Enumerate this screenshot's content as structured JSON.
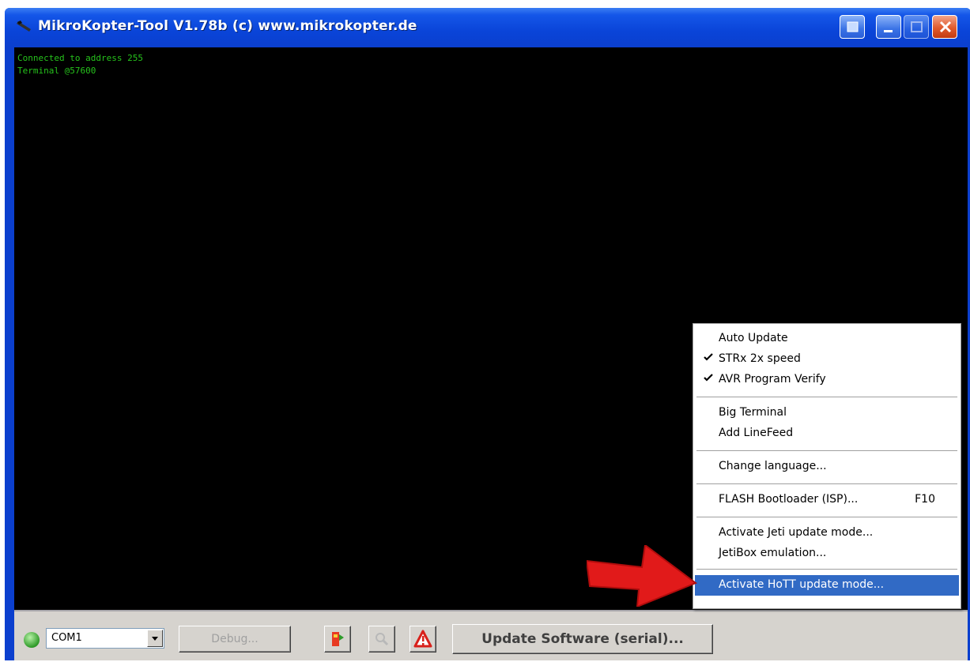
{
  "window": {
    "title": "MikroKopter-Tool V1.78b (c) www.mikrokopter.de"
  },
  "terminal": {
    "lines": [
      "Connected to address 255",
      "Terminal @57600"
    ]
  },
  "statusbar": {
    "port": "COM1",
    "debug_label": "Debug...",
    "update_label": "Update Software (serial)..."
  },
  "menu": {
    "items": [
      {
        "label": "Auto Update",
        "checked": false
      },
      {
        "label": "STRx 2x speed",
        "checked": true
      },
      {
        "label": "AVR Program Verify",
        "checked": true
      },
      {
        "label": "Big Terminal",
        "checked": false
      },
      {
        "label": "Add LineFeed",
        "checked": false
      },
      {
        "label": "Change language...",
        "checked": false
      },
      {
        "label": "FLASH Bootloader (ISP)...",
        "shortcut": "F10",
        "checked": false
      },
      {
        "label": "Activate Jeti update mode...",
        "checked": false
      },
      {
        "label": "JetiBox emulation...",
        "checked": false
      },
      {
        "label": "Activate HoTT update mode...",
        "checked": false,
        "selected": true
      }
    ]
  },
  "colors": {
    "titlebar": "#0b3fce",
    "terminal_text": "#26c21c",
    "menu_selection": "#316ac5",
    "annotation_arrow": "#e11a1a"
  },
  "icons": {
    "app": "mikrokopter-app-icon",
    "annotation": "red-arrow-icon"
  }
}
